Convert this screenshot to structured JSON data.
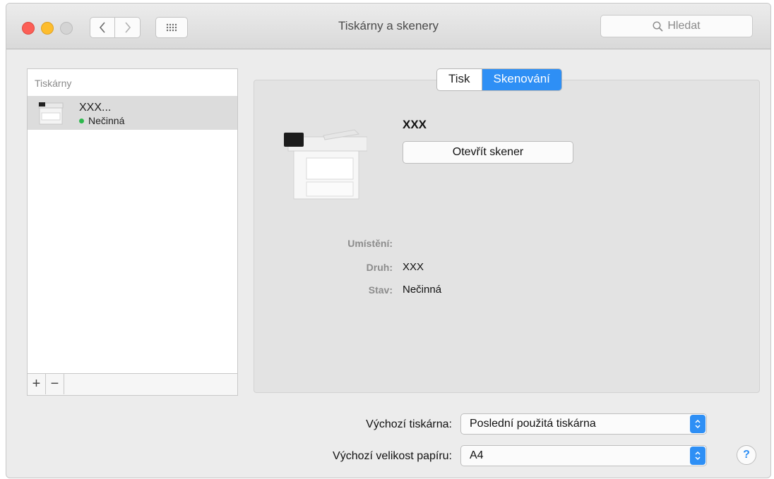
{
  "window": {
    "title": "Tiskárny a skenery",
    "search_placeholder": "Hledat"
  },
  "toolbar": {
    "back_icon": "chevron-left-icon",
    "forward_icon": "chevron-right-icon",
    "grid_icon": "grid-icon"
  },
  "sidebar": {
    "header": "Tiskárny",
    "printers": [
      {
        "name": "XXX...",
        "status": "Nečinná",
        "status_color": "#2db84d"
      }
    ],
    "add_label": "+",
    "remove_label": "−"
  },
  "tabs": [
    {
      "label": "Tisk",
      "selected": false
    },
    {
      "label": "Skenování",
      "selected": true
    }
  ],
  "device": {
    "name": "XXX",
    "open_scanner_label": "Otevřít skener",
    "location_label": "Umístění:",
    "location_value": "",
    "kind_label": "Druh:",
    "kind_value": "XXX",
    "status_label": "Stav:",
    "status_value": "Nečinná"
  },
  "defaults": {
    "printer_label": "Výchozí tiskárna:",
    "printer_value": "Poslední použitá tiskárna",
    "paper_label": "Výchozí velikost papíru:",
    "paper_value": "A4"
  },
  "help_label": "?",
  "colors": {
    "accent": "#2e8ff5",
    "status_idle": "#2db84d"
  }
}
